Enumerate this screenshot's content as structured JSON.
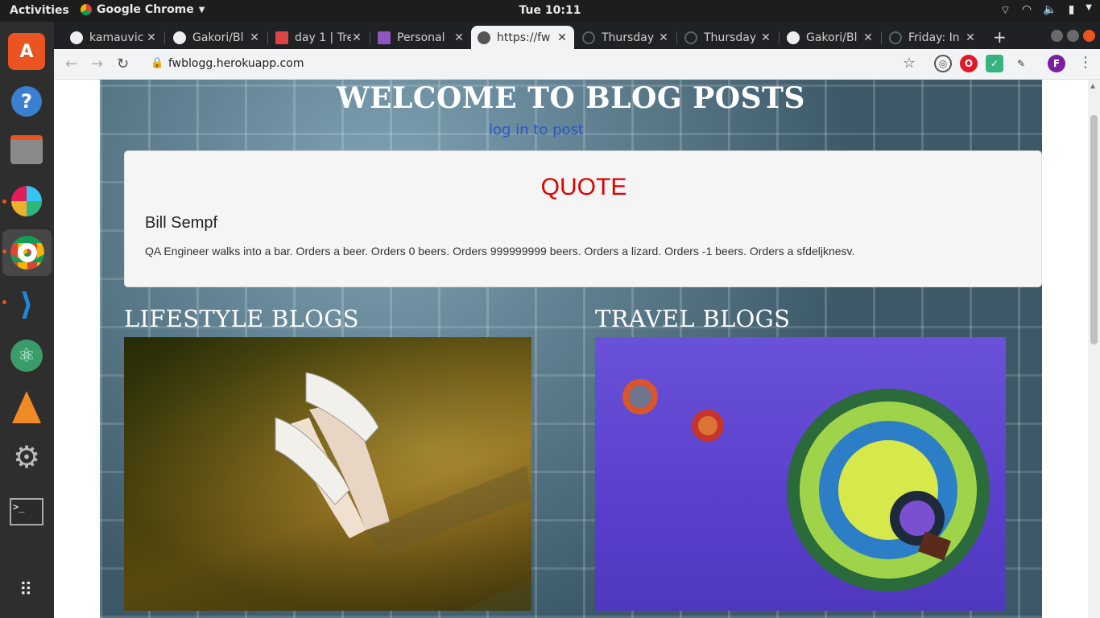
{
  "system": {
    "activities": "Activities",
    "app_name": "Google Chrome",
    "clock": "Tue 10:11"
  },
  "browser": {
    "tabs": [
      {
        "label": "kamauvic",
        "active": false
      },
      {
        "label": "Gakori/Bl",
        "active": false
      },
      {
        "label": "day 1 | Tre",
        "active": false
      },
      {
        "label": "Personal",
        "active": false
      },
      {
        "label": "https://fw",
        "active": true
      },
      {
        "label": "Thursday",
        "active": false
      },
      {
        "label": "Thursday",
        "active": false
      },
      {
        "label": "Gakori/Bl",
        "active": false
      },
      {
        "label": "Friday: In",
        "active": false
      }
    ],
    "url": "fwblogg.herokuapp.com",
    "profile_initial": "F"
  },
  "page": {
    "title": "WELCOME TO BLOG POSTS",
    "login_link": "log in to post",
    "quote": {
      "heading": "QUOTE",
      "author": "Bill Sempf",
      "text": "QA Engineer walks into a bar. Orders a beer. Orders 0 beers. Orders 999999999 beers. Orders a lizard. Orders -1 beers. Orders a sfdeljknesv."
    },
    "sections": {
      "lifestyle": "LIFESTYLE BLOGS",
      "travel": "TRAVEL BLOGS"
    }
  },
  "colors": {
    "quote_heading": "#e00000",
    "link": "#2a55c8",
    "ubuntu_accent": "#e95420"
  },
  "icons": {
    "dock": [
      "software-center-icon",
      "help-icon",
      "files-icon",
      "slack-icon",
      "chrome-icon",
      "vscode-icon",
      "atom-icon",
      "vlc-icon",
      "settings-icon",
      "terminal-icon",
      "app-grid-icon"
    ]
  }
}
